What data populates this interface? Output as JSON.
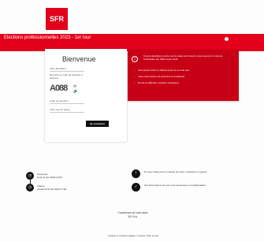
{
  "brand": {
    "logo_text": "SFR"
  },
  "header": {
    "title": "Elections professionnelles 2023 - 1er tour"
  },
  "login": {
    "title": "Bienvenue",
    "id_label": "Votre identifiant",
    "captcha_instruction": "Recopiez le code de sécurité ci-dessous",
    "captcha_value": "A088",
    "security_label": "Code de sécurité *",
    "password_label": "Votre mot de passe",
    "button_label": "Se connecter"
  },
  "info": {
    "intro": "Si votre identifiant et votre mot de passe sont corrects, vous recevrez un code de confirmation par SMS ou par email.",
    "bullets": [
      "Vous pouvez voter en utilisant le lien ou le code reçu",
      "Votre code d’accès est personnel et confidentiel",
      "En cas de difficulté, contactez l’assistance"
    ]
  },
  "timeline": [
    {
      "label": "Ouverture",
      "value": "lundi 11 juin 2023 10:00"
    },
    {
      "label": "Clôture",
      "value": "vendredi 15 juin 2023 17:00"
    }
  ],
  "tips": [
    "Si vous n’êtes pas en mesure de voter, contactez le support.",
    "Vos informations de vote sont sécurisées et confidentielles."
  ],
  "turnout": {
    "title": "Couverture du vote dans",
    "value": "62 % lu"
  },
  "footer": {
    "text": "Cookies et mentions légales • Contact • Plan du site"
  }
}
